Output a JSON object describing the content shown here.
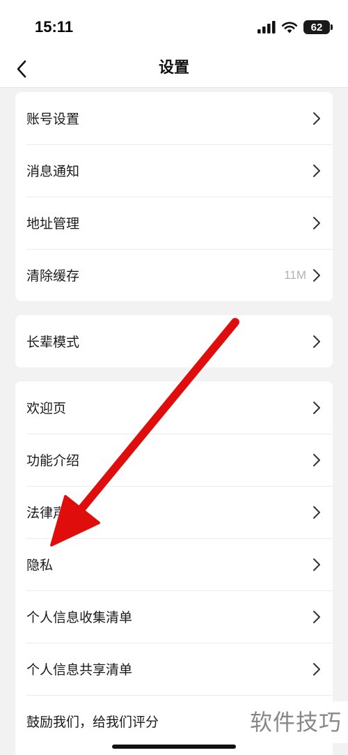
{
  "status_bar": {
    "time": "15:11",
    "battery": "62"
  },
  "header": {
    "title": "设置"
  },
  "groups": [
    {
      "items": [
        {
          "label": "账号设置"
        },
        {
          "label": "消息通知"
        },
        {
          "label": "地址管理"
        },
        {
          "label": "清除缓存",
          "value": "11M"
        }
      ]
    },
    {
      "items": [
        {
          "label": "长辈模式"
        }
      ]
    },
    {
      "items": [
        {
          "label": "欢迎页"
        },
        {
          "label": "功能介绍"
        },
        {
          "label": "法律声明"
        },
        {
          "label": "隐私"
        },
        {
          "label": "个人信息收集清单"
        },
        {
          "label": "个人信息共享清单"
        },
        {
          "label": "鼓励我们，给我们评分"
        }
      ]
    }
  ],
  "watermark": "软件技巧",
  "colors": {
    "annotation_arrow": "#e01010",
    "background": "#f2f2f2"
  }
}
